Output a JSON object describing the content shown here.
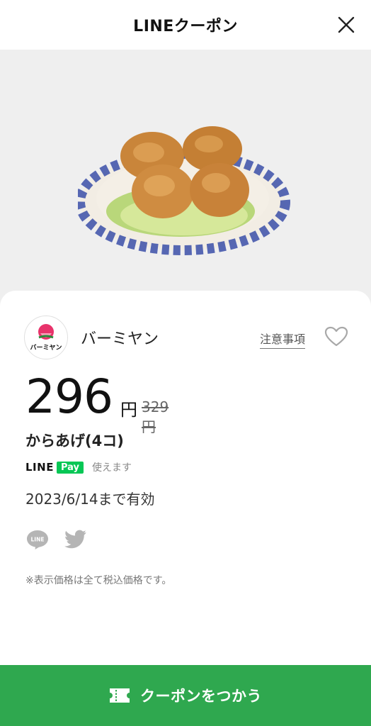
{
  "header": {
    "title": "LINEクーポン",
    "close_icon": "close-icon"
  },
  "hero": {
    "image_alt": "からあげ dish photo"
  },
  "shop": {
    "logo_text": "バーミヤン",
    "name": "バーミヤン",
    "notes_link": "注意事項",
    "favorite_icon": "heart-outline-icon"
  },
  "coupon": {
    "price": "296",
    "price_unit": "円",
    "original_price": "329円",
    "item": "からあげ(4コ)",
    "pay_brand_line": "LINE",
    "pay_brand_pay": "Pay",
    "pay_usable": "使えます",
    "validity": "2023/6/14まで有効",
    "tax_note": "※表示価格は全て税込価格です。"
  },
  "share": {
    "line_icon": "line-share-icon",
    "twitter_icon": "twitter-icon"
  },
  "footer": {
    "use_button_label": "クーポンをつかう",
    "ticket_icon": "ticket-icon"
  },
  "colors": {
    "accent_green": "#2fa84f",
    "line_pay_green": "#06c755",
    "background": "#efefef"
  }
}
